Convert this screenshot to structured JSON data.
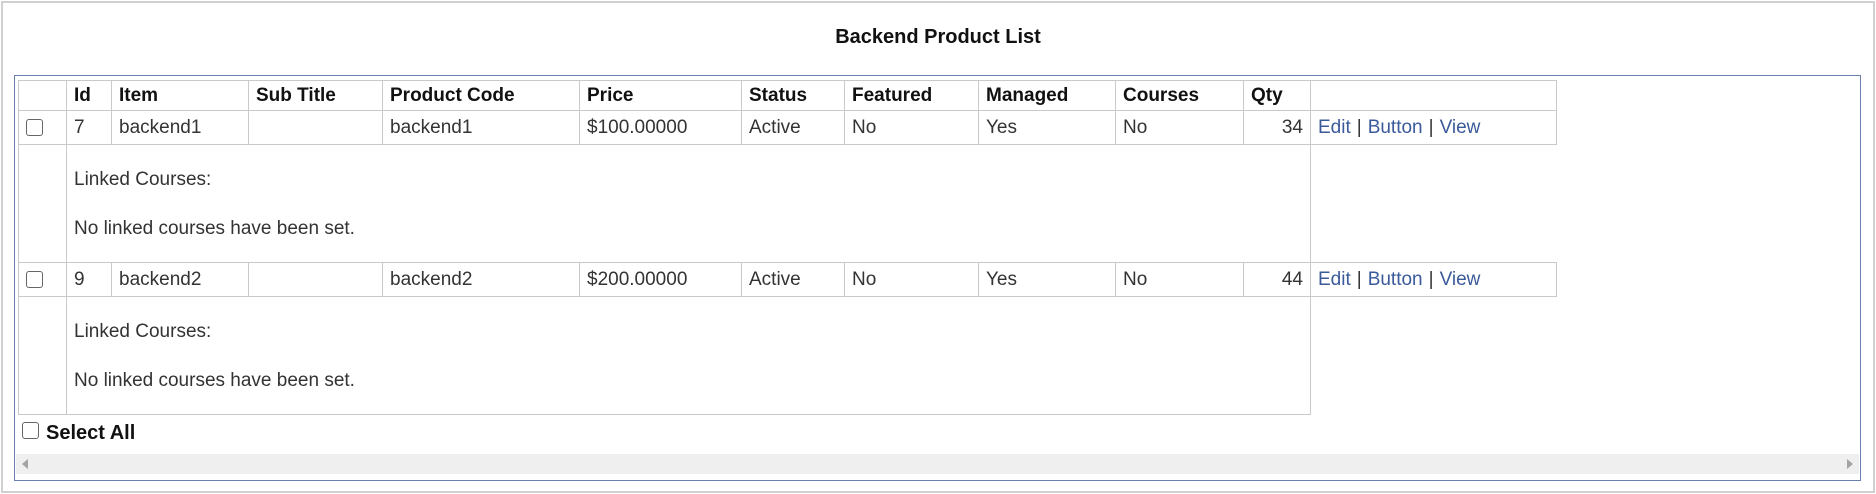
{
  "page": {
    "title": "Backend Product List"
  },
  "table": {
    "columns": [
      "Id",
      "Item",
      "Sub Title",
      "Product Code",
      "Price",
      "Status",
      "Featured",
      "Managed",
      "Courses",
      "Qty"
    ],
    "rows": [
      {
        "id": "7",
        "item": "backend1",
        "sub_title": "",
        "product_code": "backend1",
        "price": "$100.00000",
        "status": "Active",
        "featured": "No",
        "managed": "Yes",
        "courses": "No",
        "qty": "34",
        "actions": {
          "edit": "Edit",
          "button": "Button",
          "view": "View",
          "separator": "|"
        },
        "linked_courses_label": "Linked Courses:",
        "linked_courses_text": "No linked courses have been set."
      },
      {
        "id": "9",
        "item": "backend2",
        "sub_title": "",
        "product_code": "backend2",
        "price": "$200.00000",
        "status": "Active",
        "featured": "No",
        "managed": "Yes",
        "courses": "No",
        "qty": "44",
        "actions": {
          "edit": "Edit",
          "button": "Button",
          "view": "View",
          "separator": "|"
        },
        "linked_courses_label": "Linked Courses:",
        "linked_courses_text": "No linked courses have been set."
      }
    ]
  },
  "footer": {
    "select_all_label": "Select All"
  },
  "colors": {
    "link": "#3b5a9a",
    "panel_border": "#6a7fb0",
    "cell_border": "#c9c9c9"
  }
}
